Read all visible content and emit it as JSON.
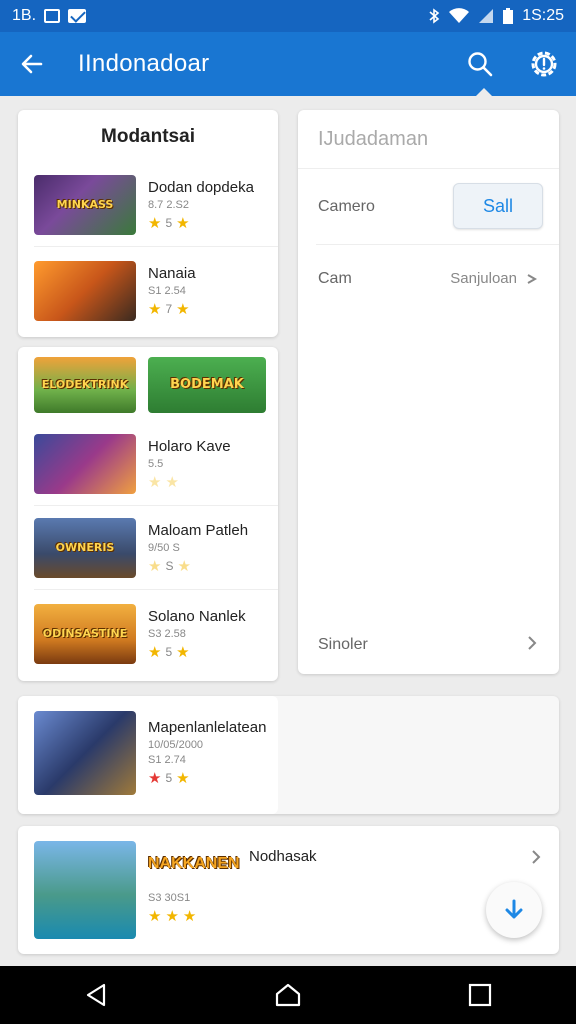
{
  "status_bar": {
    "left_text": "1B.",
    "time": "1S:25"
  },
  "app_bar": {
    "title": "IIndonadoar",
    "back_icon": "back-arrow-icon",
    "search_icon": "search-icon",
    "settings_icon": "settings-icon"
  },
  "section1": {
    "title": "Modantsai",
    "games": [
      {
        "name": "Dodan dopdeka",
        "sub": "8.7  2.S2",
        "rating": "5"
      },
      {
        "name": "Nanaia",
        "sub": "S1  2.54",
        "rating": "7"
      }
    ]
  },
  "section2": {
    "banners": [
      "ELODEKTRINK",
      "BODEMAK"
    ],
    "games": [
      {
        "name": "Holaro Kave",
        "sub": "5.5",
        "rating": ""
      },
      {
        "name": "Maloam Patleh",
        "sub": "9/50  S",
        "rating": "S"
      },
      {
        "name": "Solano Nanlek",
        "sub": "S3  2.58",
        "rating": "5"
      }
    ]
  },
  "section3": {
    "game": {
      "name": "Mapenlanlelatean",
      "sub": "10/05/2000",
      "sub2": "S1  2.74",
      "rating": "5"
    }
  },
  "section4": {
    "game": {
      "name": "Nodhasak",
      "banner": "NAKKANEN",
      "sub": "S3  30S1",
      "rating": ""
    }
  },
  "settings": {
    "title": "IJudadaman",
    "row1_label": "Camero",
    "row1_button": "Sall",
    "row2_label": "Cam",
    "row2_value": "Sanjuloan",
    "row3_label": "Sinoler"
  },
  "colors": {
    "primary": "#1976d2",
    "status": "#1565c0",
    "accent": "#1e88e5",
    "star": "#f2b600"
  }
}
